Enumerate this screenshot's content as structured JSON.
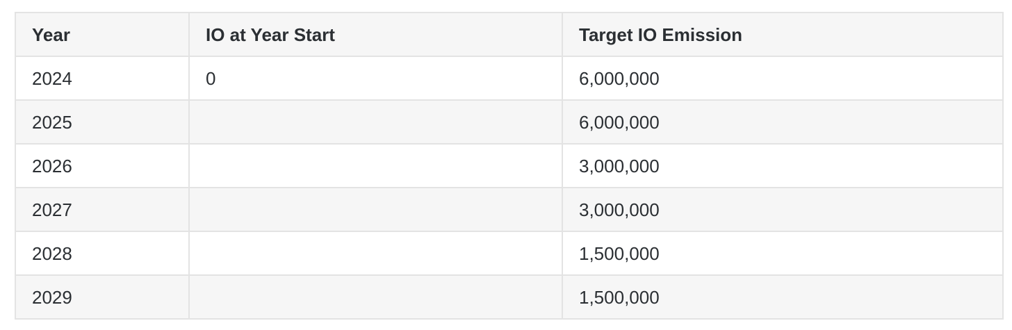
{
  "table": {
    "headers": [
      "Year",
      "IO at Year Start",
      "Target IO Emission"
    ],
    "rows": [
      [
        "2024",
        "0",
        "6,000,000"
      ],
      [
        "2025",
        "",
        "6,000,000"
      ],
      [
        "2026",
        "",
        "3,000,000"
      ],
      [
        "2027",
        "",
        "3,000,000"
      ],
      [
        "2028",
        "",
        "1,500,000"
      ],
      [
        "2029",
        "",
        "1,500,000"
      ]
    ]
  }
}
